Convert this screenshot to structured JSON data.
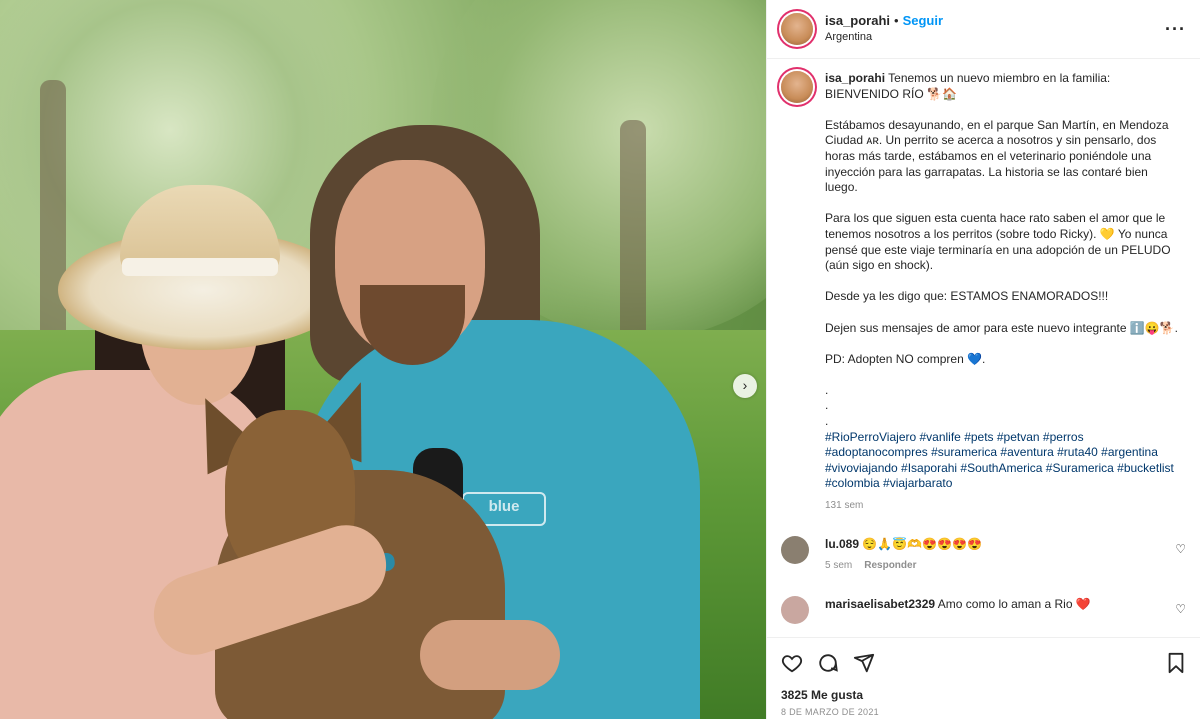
{
  "header": {
    "username": "isa_porahi",
    "separator": "•",
    "follow_label": "Seguir",
    "location": "Argentina",
    "more_label": "···"
  },
  "caption": {
    "username": "isa_porahi",
    "paragraphs": [
      "Tenemos un nuevo miembro en la familia: BIENVENIDO RÍO 🐕🏠",
      "Estábamos desayunando, en el parque San Martín, en Mendoza Ciudad ᴀʀ. Un perrito se acerca a nosotros y sin pensarlo, dos horas más tarde, estábamos en el veterinario poniéndole una inyección para las garrapatas. La historia se las contaré bien luego.",
      "Para los que siguen esta cuenta hace rato saben el amor que le tenemos nosotros a los perritos (sobre todo Ricky). 💛 Yo nunca pensé que este viaje terminaría en una adopción de un PELUDO (aún sigo en shock).",
      "Desde ya les digo que: ESTAMOS ENAMORADOS!!!",
      "Dejen sus mensajes de amor para este nuevo integrante ℹ️😛🐕.",
      "PD: Adopten NO compren 💙.",
      ".\n.\n."
    ],
    "hashtags": "#RioPerroViajero #vanlife #pets #petvan #perros #adoptanocompres #suramerica #aventura #ruta40 #argentina #vivoviajando #Isaporahi #SouthAmerica #Suramerica #bucketlist #colombia #viajarbarato",
    "time": "131 sem"
  },
  "comments": [
    {
      "username": "lu.089",
      "text": "😌🙏😇🫶😍😍😍😍",
      "time": "5 sem",
      "reply_label": "Responder",
      "avatar_color": "#8a7f70"
    },
    {
      "username": "marisaelisabet2329",
      "text": "Amo como lo aman a Rio ❤️",
      "avatar_color": "#c9a7a0"
    }
  ],
  "actions": {
    "likes": "3825 Me gusta",
    "date": "8 DE MARZO DE 2021"
  },
  "photo": {
    "shirt_text": "blue",
    "next_label": "›"
  }
}
